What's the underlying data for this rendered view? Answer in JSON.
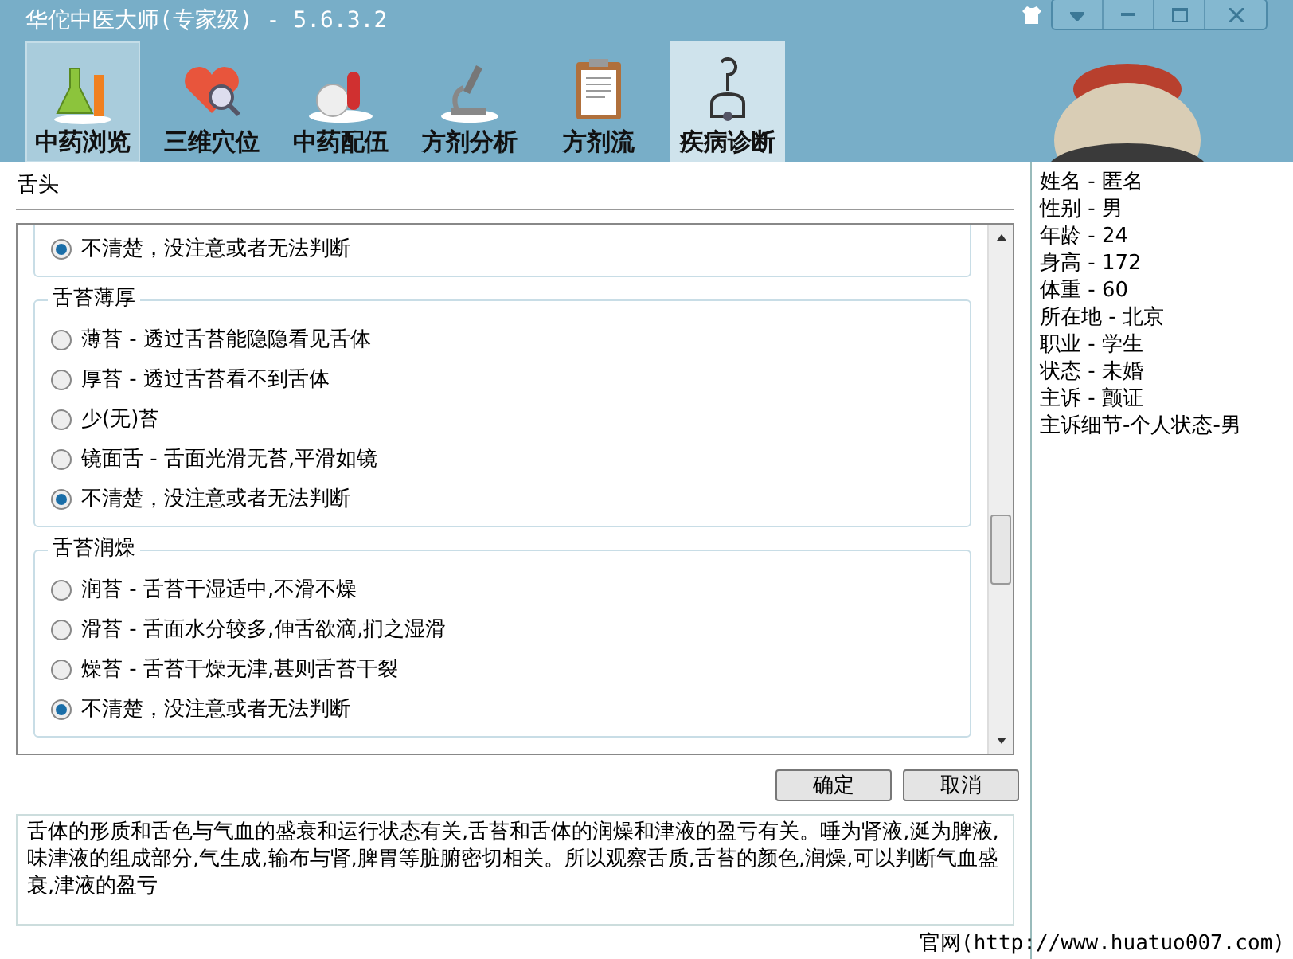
{
  "window": {
    "title": "华佗中医大师(专家级) - 5.6.3.2"
  },
  "tabs": [
    {
      "label": "中药浏览",
      "selected": false,
      "hovered": true
    },
    {
      "label": "三维穴位",
      "selected": false,
      "hovered": false
    },
    {
      "label": "中药配伍",
      "selected": false,
      "hovered": false
    },
    {
      "label": "方剂分析",
      "selected": false,
      "hovered": false
    },
    {
      "label": "方剂流",
      "selected": false,
      "hovered": false
    },
    {
      "label": "疾病诊断",
      "selected": true,
      "hovered": false
    }
  ],
  "section_title": "舌头",
  "groups": [
    {
      "options": [
        {
          "label": "不清楚，没注意或者无法判断",
          "selected": true
        }
      ]
    },
    {
      "title": "舌苔薄厚",
      "options": [
        {
          "label": "薄苔 - 透过舌苔能隐隐看见舌体",
          "selected": false
        },
        {
          "label": "厚苔 - 透过舌苔看不到舌体",
          "selected": false
        },
        {
          "label": "少(无)苔",
          "selected": false
        },
        {
          "label": "镜面舌 - 舌面光滑无苔,平滑如镜",
          "selected": false
        },
        {
          "label": "不清楚，没注意或者无法判断",
          "selected": true
        }
      ]
    },
    {
      "title": "舌苔润燥",
      "options": [
        {
          "label": "润苔 - 舌苔干湿适中,不滑不燥",
          "selected": false
        },
        {
          "label": "滑苔 - 舌面水分较多,伸舌欲滴,扪之湿滑",
          "selected": false
        },
        {
          "label": "燥苔 - 舌苔干燥无津,甚则舌苔干裂",
          "selected": false
        },
        {
          "label": "不清楚，没注意或者无法判断",
          "selected": true
        }
      ]
    }
  ],
  "buttons": [
    "确定",
    "取消"
  ],
  "description": "舌体的形质和舌色与气血的盛衰和运行状态有关,舌苔和舌体的润燥和津液的盈亏有关。唾为肾液,涎为脾液,味津液的组成部分,气生成,输布与肾,脾胃等脏腑密切相关。所以观察舌质,舌苔的颜色,润燥,可以判断气血盛衰,津液的盈亏",
  "patient_info": [
    "姓名 - 匿名",
    "性别 - 男",
    "年龄 - 24",
    "身高 - 172",
    "体重 - 60",
    "所在地 - 北京",
    "职业 - 学生",
    "状态 - 未婚",
    "主诉 - 颤证",
    "主诉细节-个人状态-男"
  ],
  "footer": "官网(http://www.huatuo007.com)"
}
